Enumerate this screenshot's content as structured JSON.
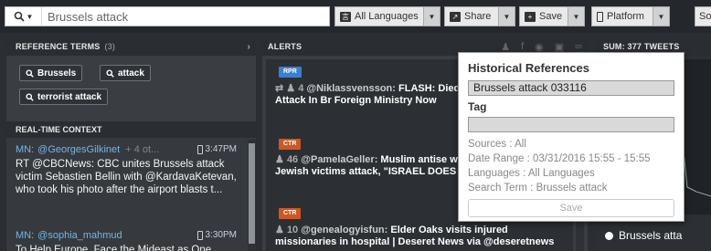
{
  "topbar": {
    "search_value": "Brussels attack",
    "languages": "All Languages",
    "share": "Share",
    "save": "Save",
    "platform": "Platform",
    "cut_label": "So"
  },
  "reference_terms": {
    "title": "REFERENCE TERMS",
    "count": "(3)",
    "terms": [
      "Brussels",
      "attack",
      "terrorist attack"
    ]
  },
  "realtime": {
    "title": "REAL-TIME CONTEXT",
    "items": [
      {
        "source": "MN:",
        "user": "@GeorgesGilkinet",
        "extra": "+ 4 ot...",
        "time": "3:47PM",
        "text": "RT @CBCNews: CBC unites Brussels attack victim Sebastien Bellin with @KardavaKetevan, who took his photo after the airport blasts t..."
      },
      {
        "source": "MN:",
        "user": "@sophia_mahmud",
        "extra": "",
        "time": "3:30PM",
        "text": "To Help Europe, Face the Mideast as One"
      }
    ]
  },
  "alerts": {
    "title": "ALERTS",
    "items": [
      {
        "badge": "RPR",
        "count": "4",
        "user": "@Niklassvensson:",
        "text": "FLASH: Died In The Terrorist Attack In Br Foreign Ministry Now"
      },
      {
        "badge": "CTR",
        "count": "46",
        "user": "@PamelaGeller:",
        "text": "Muslim antise worker trying to help Jewish victims attack, \"ISRAEL DOES NOT E..."
      },
      {
        "badge": "CTR",
        "count": "10",
        "user": "@genealogyisfun:",
        "text": "Elder Oaks visits injured missionaries in hospital | Deseret News via @deseretnews"
      }
    ]
  },
  "right_panel": {
    "title": "SUM: 377 TWEETS",
    "legend_label": "Brussels atta"
  },
  "popup": {
    "title": "Historical References",
    "name_value": "Brussels attack 033116",
    "tag_label": "Tag",
    "tag_value": "",
    "sources": "Sources : All",
    "date_range": "Date Range : 03/31/2016 15:55 - 15:55",
    "languages": "Languages : All Languages",
    "search_term": "Search Term : Brussels attack",
    "save_label": "Save"
  }
}
